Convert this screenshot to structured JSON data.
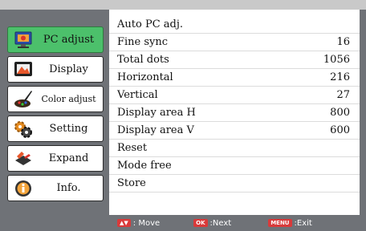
{
  "sidebar": {
    "items": [
      {
        "label": "PC adjust",
        "icon": "pc-adjust-icon",
        "active": true
      },
      {
        "label": "Display",
        "icon": "display-icon",
        "active": false
      },
      {
        "label": "Color adjust",
        "icon": "color-adjust-icon",
        "active": false
      },
      {
        "label": "Setting",
        "icon": "setting-icon",
        "active": false
      },
      {
        "label": "Expand",
        "icon": "expand-icon",
        "active": false
      },
      {
        "label": "Info.",
        "icon": "info-icon",
        "active": false
      }
    ]
  },
  "menu": {
    "rows": [
      {
        "name": "Auto PC adj.",
        "value": ""
      },
      {
        "name": "Fine sync",
        "value": "16"
      },
      {
        "name": "Total dots",
        "value": "1056"
      },
      {
        "name": "Horizontal",
        "value": "216"
      },
      {
        "name": "Vertical",
        "value": "27"
      },
      {
        "name": "Display area H",
        "value": "800"
      },
      {
        "name": "Display area V",
        "value": "600"
      },
      {
        "name": "Reset",
        "value": ""
      },
      {
        "name": "Mode free",
        "value": ""
      },
      {
        "name": "Store",
        "value": ""
      }
    ]
  },
  "footer": {
    "move_key": "▲▼",
    "move_label": ": Move",
    "next_key": "OK",
    "next_label": ":Next",
    "exit_key": "MENU",
    "exit_label": ":Exit"
  },
  "colors": {
    "active_item": "#4cc06b",
    "background": "#6f7277",
    "key_badge": "#d93a3a"
  }
}
